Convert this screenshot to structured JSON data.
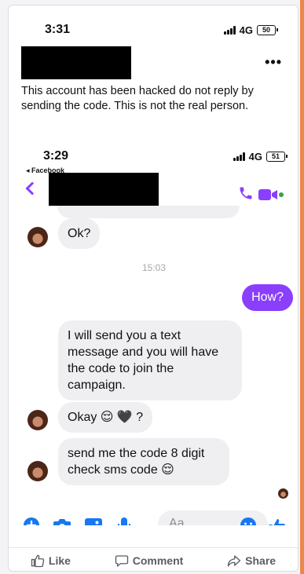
{
  "outer_status": {
    "time": "3:31",
    "network": "4G",
    "battery": "50"
  },
  "post": {
    "more_glyph": "•••",
    "warning_text": "This account has been hacked do not reply by sending the code. This is not the real person."
  },
  "inner_status": {
    "time": "3:29",
    "back_label": "◂ Facebook",
    "network": "4G",
    "battery": "51"
  },
  "chat": {
    "messages": [
      {
        "side": "in",
        "text": "Ok?"
      },
      {
        "type": "timestamp",
        "text": "15:03"
      },
      {
        "side": "out",
        "text": "How?"
      },
      {
        "side": "in",
        "text": "I will send you a text message and you will have the code to join the campaign."
      },
      {
        "side": "in",
        "text": "Okay 😌 🖤 ?"
      },
      {
        "side": "in",
        "text": "send me the code 8 digit check sms code 😌"
      }
    ],
    "composer_placeholder": "Aa",
    "accent_color": "#8a3ffc",
    "composer_color": "#1877f2"
  },
  "post_actions": {
    "like": "Like",
    "comment": "Comment",
    "share": "Share"
  }
}
